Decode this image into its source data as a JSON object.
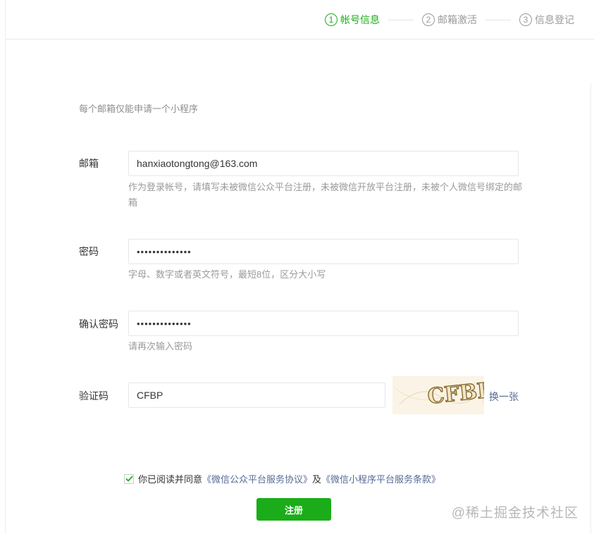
{
  "stepper": {
    "steps": [
      {
        "num": "1",
        "label": "帐号信息"
      },
      {
        "num": "2",
        "label": "邮箱激活"
      },
      {
        "num": "3",
        "label": "信息登记"
      }
    ]
  },
  "form": {
    "tip": "每个邮箱仅能申请一个小程序",
    "email": {
      "label": "邮箱",
      "value": "hanxiaotongtong@163.com",
      "hint": "作为登录帐号，请填写未被微信公众平台注册，未被微信开放平台注册，未被个人微信号绑定的邮箱"
    },
    "password": {
      "label": "密码",
      "value": "••••••••••••••",
      "hint": "字母、数字或者英文符号，最短8位，区分大小写"
    },
    "confirm_password": {
      "label": "确认密码",
      "value": "••••••••••••••",
      "hint": "请再次输入密码"
    },
    "captcha": {
      "label": "验证码",
      "value": "CFBP",
      "image_text": "CFBP",
      "refresh_label": "换一张"
    }
  },
  "agreement": {
    "prefix": "你已阅读并同意",
    "link1": "《微信公众平台服务协议》",
    "middle": "及",
    "link2": "《微信小程序平台服务条款》",
    "checked": true
  },
  "register_label": "注册",
  "watermark": "@稀土掘金技术社区",
  "colors": {
    "accent": "#1aad19",
    "link": "#576b95"
  }
}
